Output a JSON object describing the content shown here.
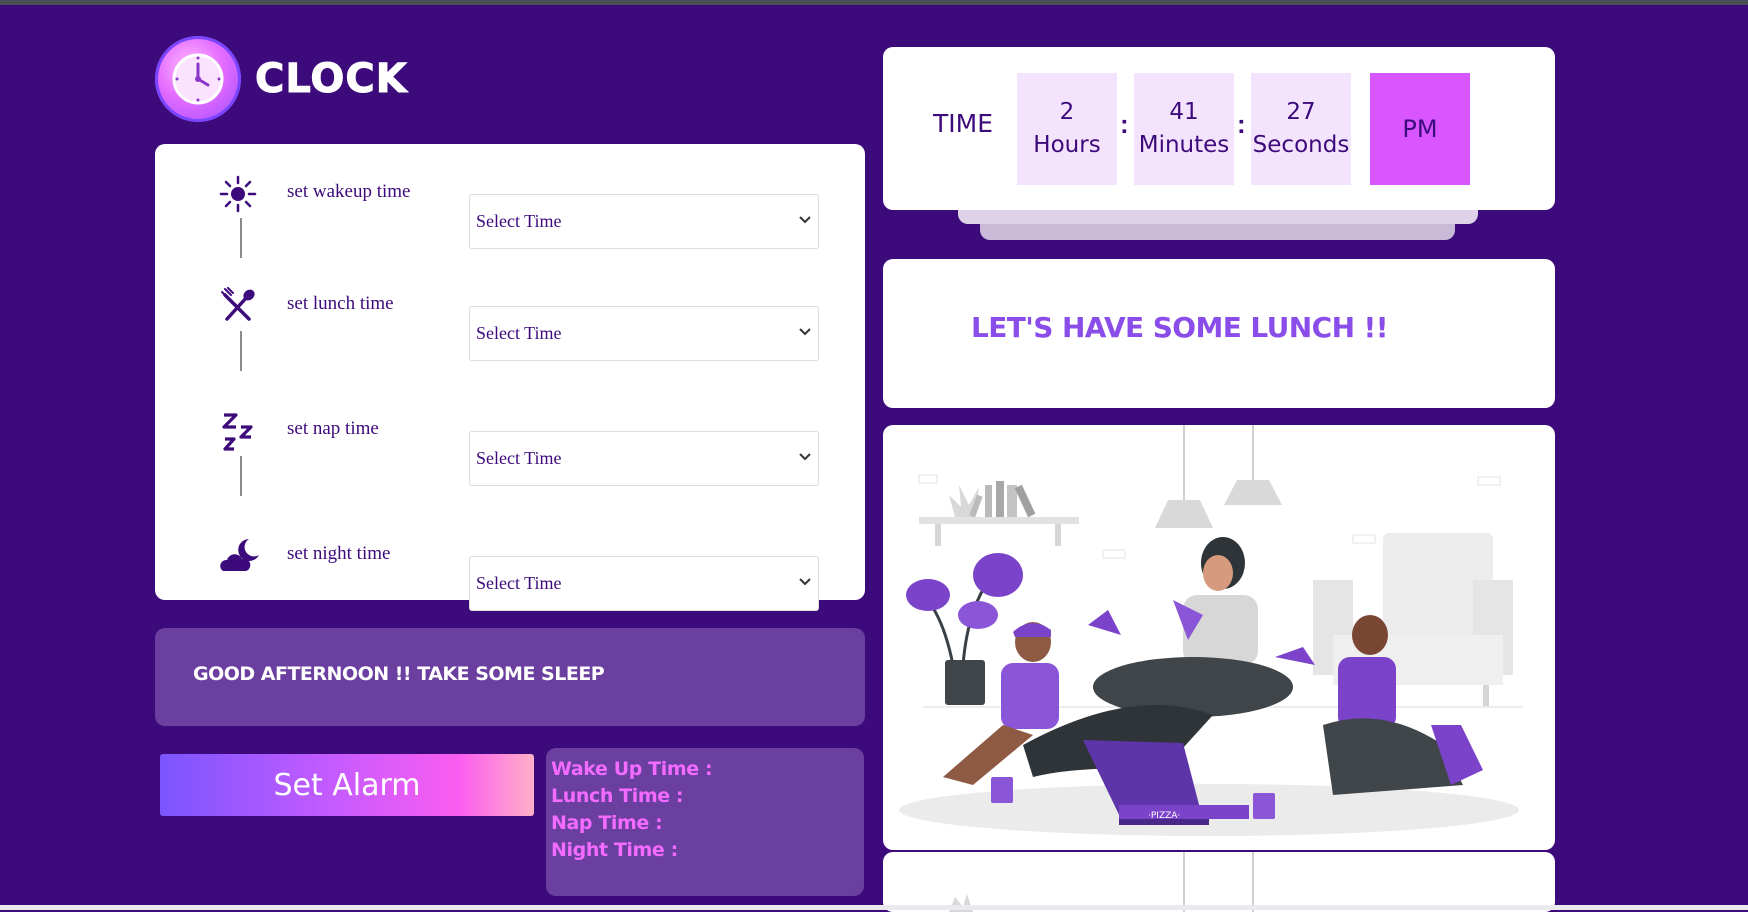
{
  "app": {
    "title": "CLOCK"
  },
  "settings": {
    "rows": [
      {
        "label": "set wakeup time",
        "icon": "sun-icon",
        "select_value": "Select Time"
      },
      {
        "label": "set lunch time",
        "icon": "fork-spoon-icon",
        "select_value": "Select Time"
      },
      {
        "label": "set nap time",
        "icon": "zzz-icon",
        "select_value": "Select Time"
      },
      {
        "label": "set night time",
        "icon": "moon-cloud-icon",
        "select_value": "Select Time"
      }
    ]
  },
  "message": {
    "text": "GOOD AFTERNOON !! TAKE SOME SLEEP"
  },
  "buttons": {
    "set_alarm": "Set Alarm"
  },
  "summary": {
    "wake": "Wake Up Time :",
    "lunch": "Lunch Time :",
    "nap": "Nap Time :",
    "night": "Night Time :"
  },
  "clock": {
    "label": "TIME",
    "hours_value": "2",
    "hours_label": "Hours",
    "minutes_value": "41",
    "minutes_label": "Minutes",
    "seconds_value": "27",
    "seconds_label": "Seconds",
    "separator": ":",
    "ampm": "PM"
  },
  "greeting": {
    "text": "LET'S HAVE SOME LUNCH !!"
  },
  "illustration": {
    "box_text": "·PIZZA·"
  },
  "colors": {
    "background": "#3d0a7c",
    "accent": "#d956ff",
    "purple_mid": "#6a3f9f",
    "lunch_text": "#8a4dea",
    "summary_text": "#f46bff"
  }
}
